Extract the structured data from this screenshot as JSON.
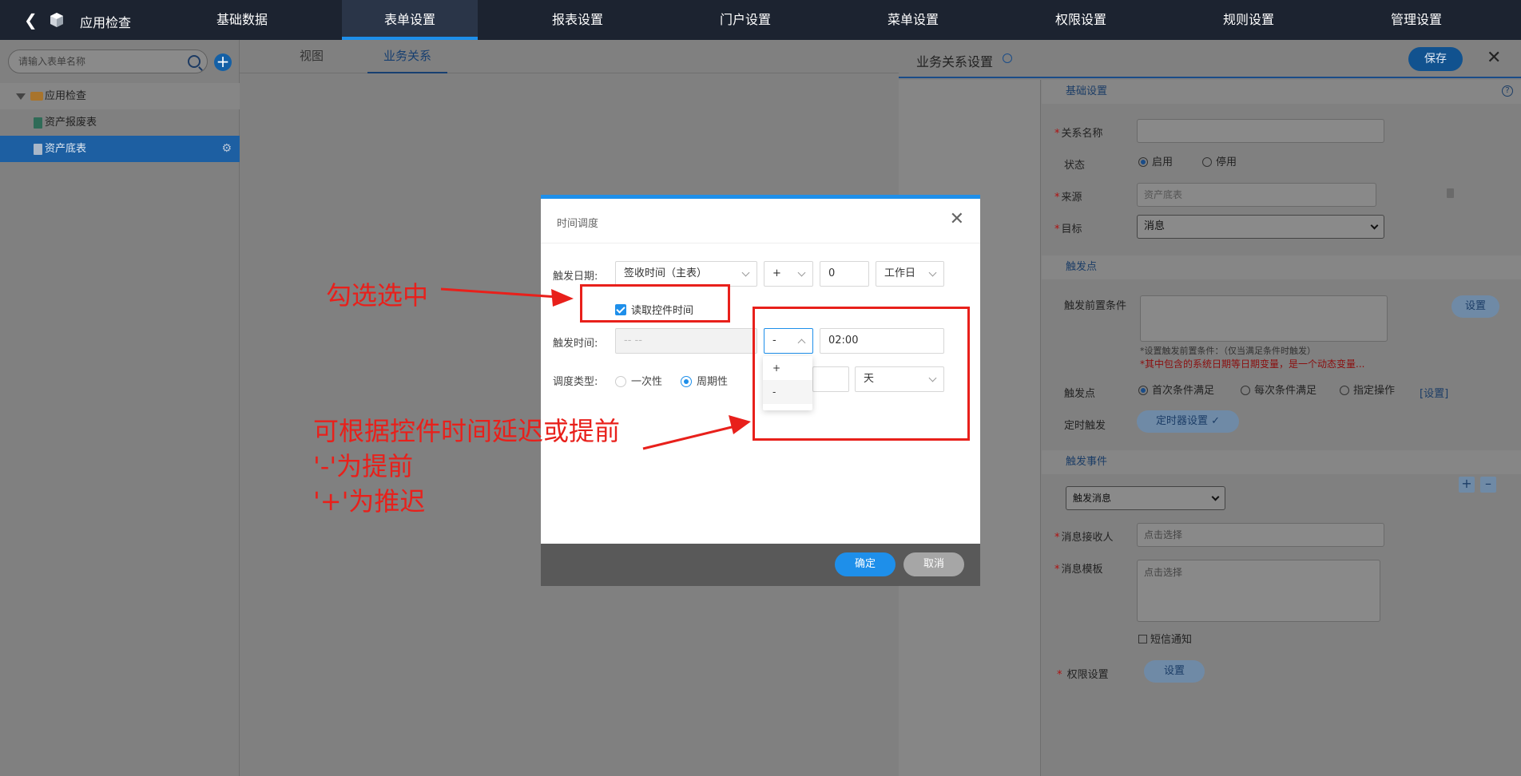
{
  "topbar": {
    "back_icon": "chevron-left-icon",
    "logo_icon": "cube-icon",
    "app_title": "应用检查",
    "nav": [
      "基础数据",
      "表单设置",
      "报表设置",
      "门户设置",
      "菜单设置",
      "权限设置",
      "规则设置",
      "管理设置"
    ],
    "active_index": 1
  },
  "sidebar": {
    "search_placeholder": "请输入表单名称",
    "add_icon": "plus-circle-icon",
    "collapse_icon": "double-chevron-left-icon",
    "tree": {
      "root": "应用检查",
      "children": [
        "资产报废表",
        "资产底表"
      ],
      "selected_index": 1
    }
  },
  "main": {
    "tabs": [
      "视图",
      "业务关系"
    ],
    "active_tab": 1,
    "ghost_text": "据"
  },
  "right_panel": {
    "title": "业务关系设置",
    "save_label": "保存",
    "sections": {
      "basic": "基础设置",
      "trigger_point": "触发点",
      "trigger_event": "触发事件"
    },
    "fields": {
      "relation_name_label": "关系名称",
      "relation_name_value": "",
      "status_label": "状态",
      "status_options": [
        "启用",
        "停用"
      ],
      "status_selected": 0,
      "source_label": "来源",
      "source_value": "资产底表",
      "target_label": "目标",
      "target_value": "消息",
      "pre_condition_label": "触发前置条件",
      "pre_condition_button": "设置",
      "note_gray": "*设置触发前置条件：（仅当满足条件时触发）",
      "note_red": "*其中包含的系统日期等日期变量，是一个动态变量...",
      "trigger_point_label": "触发点",
      "trigger_point_options": [
        "首次条件满足",
        "每次条件满足",
        "指定操作"
      ],
      "trigger_point_selected": 0,
      "trigger_point_link": "[设置]",
      "timed_trigger_label": "定时触发",
      "timer_button": "定时器设置",
      "event_select_value": "触发消息",
      "receiver_label": "消息接收人",
      "receiver_placeholder": "点击选择",
      "template_label": "消息模板",
      "template_placeholder": "点击选择",
      "sms_label": "短信通知",
      "permission_label": "权限设置",
      "permission_button": "设置"
    }
  },
  "dialog": {
    "title": "时间调度",
    "trigger_date_label": "触发日期:",
    "trigger_date_field": "签收时间（主表）",
    "date_sign": "+",
    "date_offset": "0",
    "date_unit": "工作日",
    "read_control_time_label": "读取控件时间",
    "read_control_time_checked": true,
    "trigger_time_label": "触发时间:",
    "trigger_time_placeholder": "-- --",
    "time_sign": "-",
    "time_value": "02:00",
    "dropdown_options": [
      "+",
      "-"
    ],
    "schedule_type_label": "调度类型:",
    "schedule_options": [
      "一次性",
      "周期性"
    ],
    "schedule_selected": 1,
    "period_unit": "天",
    "ok_label": "确定",
    "cancel_label": "取消"
  },
  "annotations": {
    "check_note": "勾选选中",
    "delay_note_lines": [
      "可根据控件时间延迟或提前",
      "'-'为提前",
      "'+'为推迟"
    ],
    "color": "#e8201b"
  }
}
